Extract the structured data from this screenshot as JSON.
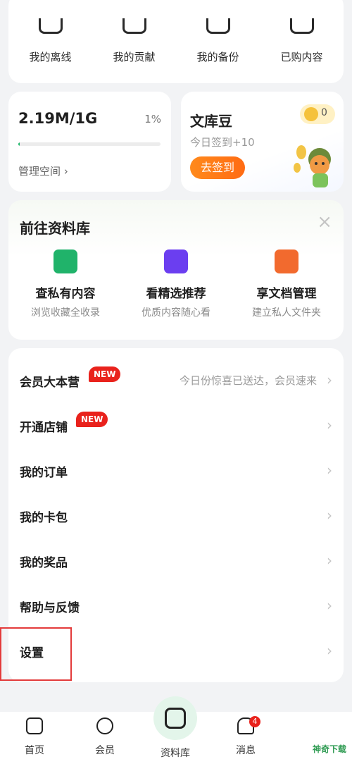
{
  "quick_links": [
    {
      "label": "我的离线",
      "icon": "offline-icon"
    },
    {
      "label": "我的贡献",
      "icon": "contribution-icon"
    },
    {
      "label": "我的备份",
      "icon": "backup-icon"
    },
    {
      "label": "已购内容",
      "icon": "purchased-icon"
    }
  ],
  "storage": {
    "amount": "2.19M/1G",
    "percent": "1%",
    "progress": 0.01,
    "link": "管理空间 ›"
  },
  "bean": {
    "title": "文库豆",
    "sub": "今日签到+10",
    "button": "去签到",
    "count": "0"
  },
  "library": {
    "title": "前往资料库",
    "close": "×",
    "features": [
      {
        "name": "查私有内容",
        "desc": "浏览收藏全收录",
        "color": "#20b36a"
      },
      {
        "name": "看精选推荐",
        "desc": "优质内容随心看",
        "color": "#6b3ef0"
      },
      {
        "name": "享文档管理",
        "desc": "建立私人文件夹",
        "color": "#f26a2e"
      }
    ]
  },
  "menu": {
    "items": [
      {
        "label": "会员大本营",
        "tag": "NEW",
        "note": "今日份惊喜已送达，会员速来"
      },
      {
        "label": "开通店铺",
        "tag": "NEW",
        "note": ""
      },
      {
        "label": "我的订单",
        "tag": "",
        "note": ""
      },
      {
        "label": "我的卡包",
        "tag": "",
        "note": ""
      },
      {
        "label": "我的奖品",
        "tag": "",
        "note": ""
      },
      {
        "label": "帮助与反馈",
        "tag": "",
        "note": ""
      },
      {
        "label": "设置",
        "tag": "",
        "note": ""
      }
    ],
    "chevron": "›"
  },
  "tabbar": {
    "tabs": [
      {
        "label": "首页",
        "icon": "home-icon"
      },
      {
        "label": "会员",
        "icon": "member-icon"
      },
      {
        "label": "资料库",
        "icon": "library-icon"
      },
      {
        "label": "消息",
        "icon": "bell-icon"
      }
    ],
    "message_badge": "4"
  },
  "watermark": "神奇下载"
}
